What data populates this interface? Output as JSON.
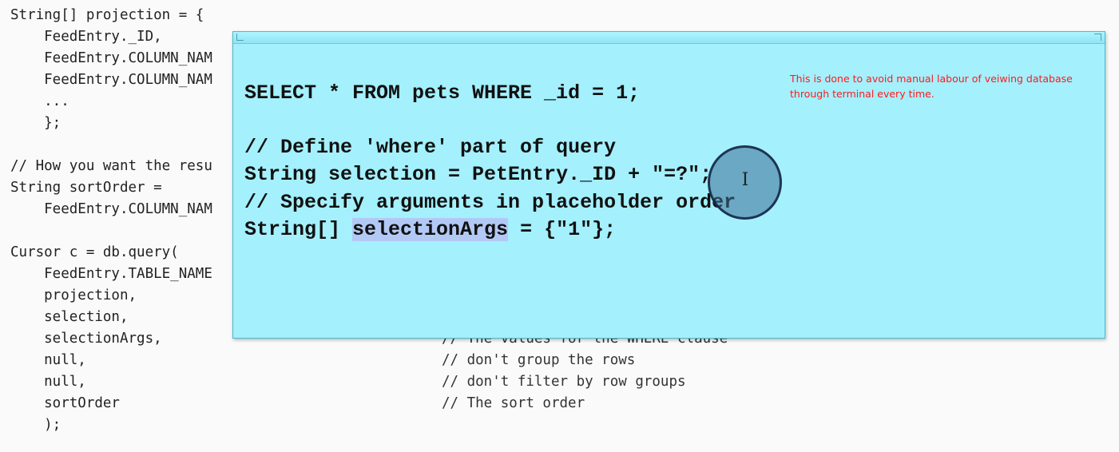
{
  "background_code": [
    {
      "code": "String[] projection = {",
      "comment": ""
    },
    {
      "code": "    FeedEntry._ID,",
      "comment": ""
    },
    {
      "code": "    FeedEntry.COLUMN_NAM",
      "comment": ""
    },
    {
      "code": "    FeedEntry.COLUMN_NAM",
      "comment": ""
    },
    {
      "code": "    ...",
      "comment": ""
    },
    {
      "code": "    };",
      "comment": ""
    },
    {
      "code": "",
      "comment": ""
    },
    {
      "code": "// How you want the resu",
      "comment": ""
    },
    {
      "code": "String sortOrder =",
      "comment": ""
    },
    {
      "code": "    FeedEntry.COLUMN_NAM",
      "comment": ""
    },
    {
      "code": "",
      "comment": ""
    },
    {
      "code": "Cursor c = db.query(",
      "comment": ""
    },
    {
      "code": "    FeedEntry.TABLE_NAME",
      "comment": ""
    },
    {
      "code": "    projection,",
      "comment": ""
    },
    {
      "code": "    selection,",
      "comment": ""
    },
    {
      "code": "    selectionArgs,",
      "comment": "// The values for the WHERE clause"
    },
    {
      "code": "    null,",
      "comment": "// don't group the rows"
    },
    {
      "code": "    null,",
      "comment": "// don't filter by row groups"
    },
    {
      "code": "    sortOrder",
      "comment": "// The sort order"
    },
    {
      "code": "    );",
      "comment": ""
    }
  ],
  "popup": {
    "line1": "SELECT * FROM pets WHERE _id = 1;",
    "line2": "// Define 'where' part of query",
    "line3": "String selection = PetEntry._ID + \"=?\";",
    "line4": "// Specify arguments in placeholder order",
    "line5_prefix": "String[] ",
    "line5_highlight": "selectionArgs",
    "line5_suffix": " = {\"1\"};"
  },
  "annotation": "This is done to avoid manual labour of veiwing database through terminal every time.",
  "cursor_glyph": "I",
  "colors": {
    "popup_bg": "#a4f0fd",
    "annotation": "#ff1a1a",
    "highlight": "#b3c9f5"
  }
}
